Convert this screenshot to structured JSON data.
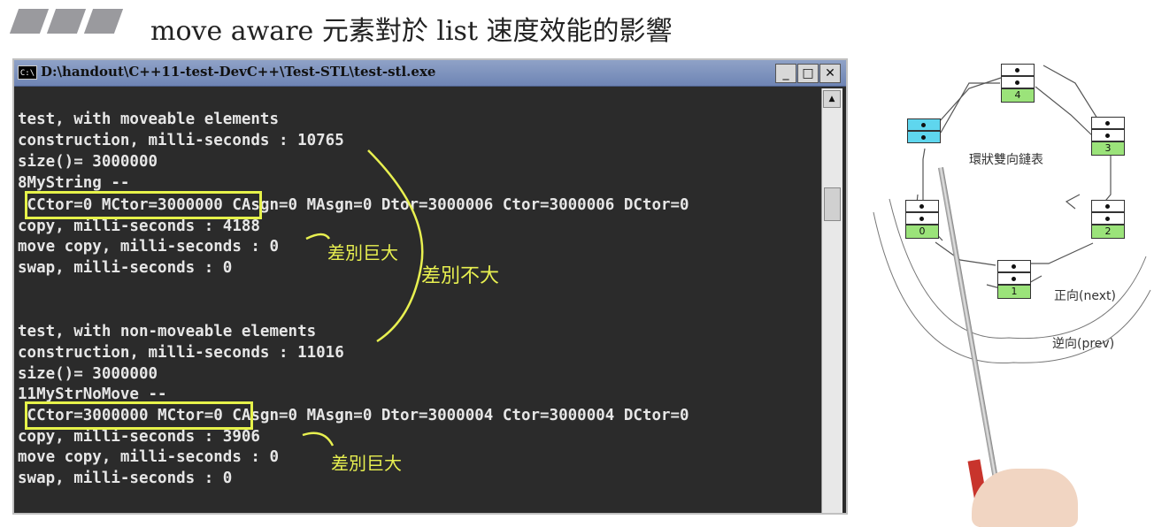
{
  "slide": {
    "title": "move aware 元素對於 list 速度效能的影響"
  },
  "window": {
    "icon_text": "C:\\",
    "title": "D:\\handout\\C++11-test-DevC++\\Test-STL\\test-stl.exe",
    "min_symbol": "_",
    "max_symbol": "□",
    "close_symbol": "✕",
    "scroll_up_symbol": "▲"
  },
  "console_lines": [
    "test, with moveable elements",
    "construction, milli-seconds : 10765",
    "size()= 3000000",
    "8MyString --",
    " CCtor=0 MCtor=3000000 CAsgn=0 MAsgn=0 Dtor=3000006 Ctor=3000006 DCtor=0",
    "copy, milli-seconds : 4188",
    "move copy, milli-seconds : 0",
    "swap, milli-seconds : 0",
    "",
    "test, with non-moveable elements",
    "construction, milli-seconds : 11016",
    "size()= 3000000",
    "11MyStrNoMove --",
    " CCtor=3000000 MCtor=0 CAsgn=0 MAsgn=0 Dtor=3000004 Ctor=3000004 DCtor=0",
    "copy, milli-seconds : 3906",
    "move copy, milli-seconds : 0",
    "swap, milli-seconds : 0"
  ],
  "annotations": {
    "big_diff_1": "差別巨大",
    "small_diff": "差別不大",
    "big_diff_2": "差別巨大"
  },
  "diagram": {
    "caption": "環狀雙向鏈表",
    "forward": "正向(next)",
    "backward": "逆向(prev)",
    "nodes": [
      "4",
      "3",
      "0",
      "2",
      "1"
    ]
  },
  "colors": {
    "highlight": "#e6f24a",
    "console_bg": "#2b2b2b",
    "console_text": "#e6e6e6",
    "node_green": "#9be37a",
    "node_head": "#5fd6ee"
  }
}
